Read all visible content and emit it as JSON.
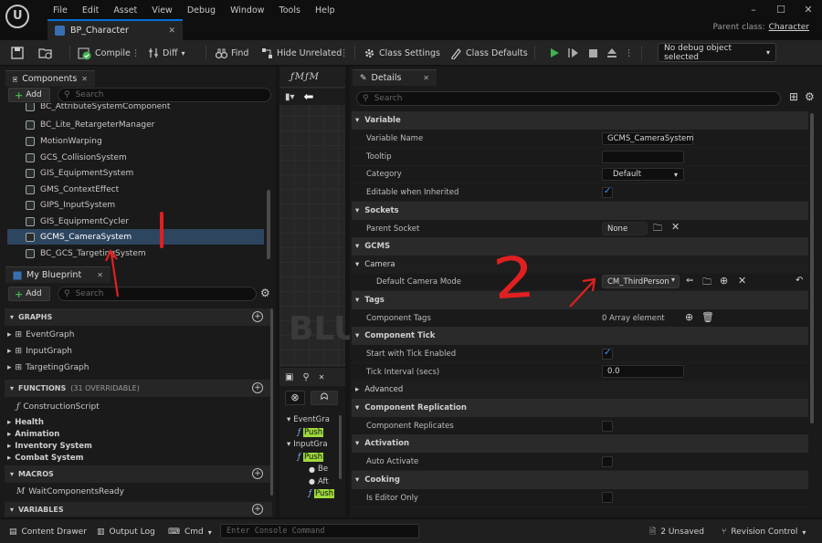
{
  "menu": [
    "File",
    "Edit",
    "Asset",
    "View",
    "Debug",
    "Window",
    "Tools",
    "Help"
  ],
  "doc_tab": {
    "title": "BP_Character",
    "close": "✕"
  },
  "parent_class": {
    "label": "Parent class:",
    "value": "Character"
  },
  "window_controls": [
    "–",
    "☐",
    "✕"
  ],
  "toolbar": {
    "compile": "Compile",
    "diff": "Diff",
    "find": "Find",
    "hide_unrelated": "Hide Unrelated",
    "class_settings": "Class Settings",
    "class_defaults": "Class Defaults",
    "debug_object": "No debug object selected"
  },
  "components": {
    "tab": "Components",
    "add": "Add",
    "search_placeholder": "Search",
    "items": [
      "BC_AttributeSystemComponent",
      "BC_Lite_RetargeterManager",
      "MotionWarping",
      "GCS_CollisionSystem",
      "GIS_EquipmentSystem",
      "GMS_ContextEffect",
      "GIPS_InputSystem",
      "GIS_EquipmentCycler",
      "GCMS_CameraSystem",
      "BC_GCS_TargetingSystem"
    ],
    "selected_index": 8
  },
  "my_blueprint": {
    "tab": "My Blueprint",
    "add": "Add",
    "search_placeholder": "Search",
    "graphs_header": "GRAPHS",
    "graphs": [
      "EventGraph",
      "InputGraph",
      "TargetingGraph"
    ],
    "functions_header": "FUNCTIONS",
    "functions_count": "(31 OVERRIDABLE)",
    "functions": [
      "ConstructionScript"
    ],
    "categories": [
      "Health",
      "Animation",
      "Inventory System",
      "Combat System"
    ],
    "macros_header": "MACROS",
    "macros": [
      "WaitComponentsReady"
    ],
    "variables_header": "VARIABLES"
  },
  "graph": {
    "watermark": "BLU"
  },
  "find_panel": {
    "tree": [
      {
        "label": "EventGra",
        "level": 0
      },
      {
        "label": "Push",
        "level": 1,
        "tag": true
      },
      {
        "label": "InputGra",
        "level": 0
      },
      {
        "label": "Push",
        "level": 1,
        "tag": true
      },
      {
        "label": "Be",
        "level": 2
      },
      {
        "label": "Aft",
        "level": 2
      },
      {
        "label": "Push",
        "level": 2,
        "tag": true
      }
    ]
  },
  "details": {
    "tab": "Details",
    "search_placeholder": "Search",
    "variable_header": "Variable",
    "variable_name_label": "Variable Name",
    "variable_name": "GCMS_CameraSystem",
    "tooltip_label": "Tooltip",
    "category_label": "Category",
    "category_value": "Default",
    "editable_label": "Editable when Inherited",
    "sockets_header": "Sockets",
    "parent_socket_label": "Parent Socket",
    "parent_socket_value": "None",
    "gcms_header": "GCMS",
    "camera_header": "Camera",
    "default_camera_mode_label": "Default Camera Mode",
    "default_camera_mode_value": "CM_ThirdPerson",
    "tags_header": "Tags",
    "component_tags_label": "Component Tags",
    "component_tags_value": "0 Array element",
    "component_tick_header": "Component Tick",
    "start_tick_label": "Start with Tick Enabled",
    "tick_interval_label": "Tick Interval (secs)",
    "tick_interval_value": "0.0",
    "advanced_header": "Advanced",
    "component_replication_header": "Component Replication",
    "component_replicates_label": "Component Replicates",
    "activation_header": "Activation",
    "auto_activate_label": "Auto Activate",
    "cooking_header": "Cooking",
    "is_editor_only_label": "Is Editor Only"
  },
  "statusbar": {
    "content_drawer": "Content Drawer",
    "output_log": "Output Log",
    "cmd": "Cmd",
    "console_placeholder": "Enter Console Command",
    "unsaved": "2 Unsaved",
    "revision_control": "Revision Control"
  },
  "annotations": {
    "one": "1",
    "two": "2"
  },
  "colors": {
    "accent": "#0070e0",
    "selection": "#2e4560",
    "check": "#3d8fff",
    "annotation": "#e02020",
    "play": "#3fb34f"
  }
}
